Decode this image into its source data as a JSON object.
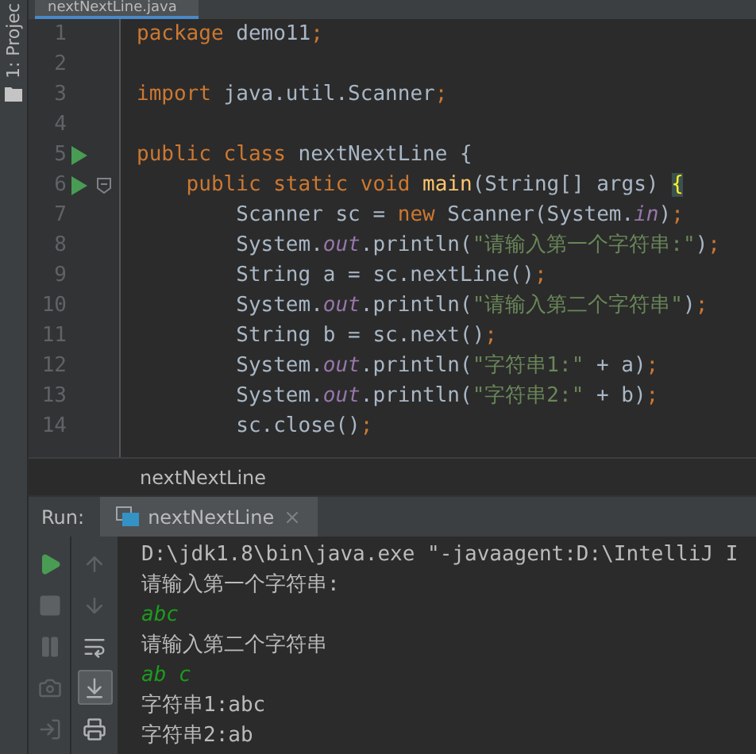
{
  "side_panel": {
    "label": "1: Projec"
  },
  "editor_tab": {
    "label": "nextNextLine.java"
  },
  "code_lines": [
    {
      "number": "1",
      "run_icon": false,
      "fold_marker": false,
      "tokens": [
        {
          "t": "package",
          "kind": "kw"
        },
        {
          "t": " demo11",
          "kind": "plain"
        },
        {
          "t": ";",
          "kind": "kw"
        }
      ]
    },
    {
      "number": "2",
      "run_icon": false,
      "fold_marker": false
    },
    {
      "number": "3",
      "run_icon": false,
      "fold_marker": false,
      "tokens": [
        {
          "t": "import",
          "kind": "kw"
        },
        {
          "t": " java.util.Scanner",
          "kind": "plain"
        },
        {
          "t": ";",
          "kind": "kw"
        }
      ]
    },
    {
      "number": "4",
      "run_icon": false,
      "fold_marker": false
    },
    {
      "number": "5",
      "run_icon": true,
      "fold_marker": false,
      "tokens": [
        {
          "t": "public class",
          "kind": "kw"
        },
        {
          "t": " nextNextLine {",
          "kind": "plain"
        }
      ]
    },
    {
      "number": "6",
      "run_icon": true,
      "fold_marker": true,
      "tokens": [
        {
          "t": "    public static void ",
          "kind": "kw"
        },
        {
          "t": "main",
          "kind": "method"
        },
        {
          "t": "(String[] args) ",
          "kind": "plain"
        },
        {
          "t": "{",
          "kind": "match"
        }
      ]
    },
    {
      "number": "7",
      "run_icon": false,
      "fold_marker": false,
      "tokens": [
        {
          "t": "        Scanner sc = ",
          "kind": "plain"
        },
        {
          "t": "new",
          "kind": "kw"
        },
        {
          "t": " Scanner(System.",
          "kind": "plain"
        },
        {
          "t": "in",
          "kind": "field"
        },
        {
          "t": ")",
          "kind": "plain"
        },
        {
          "t": ";",
          "kind": "kw"
        }
      ]
    },
    {
      "number": "8",
      "run_icon": false,
      "fold_marker": false,
      "tokens": [
        {
          "t": "        System.",
          "kind": "plain"
        },
        {
          "t": "out",
          "kind": "field"
        },
        {
          "t": ".println(",
          "kind": "plain"
        },
        {
          "t": "\"请输入第一个字符串:\"",
          "kind": "str"
        },
        {
          "t": ")",
          "kind": "plain"
        },
        {
          "t": ";",
          "kind": "kw"
        }
      ]
    },
    {
      "number": "9",
      "run_icon": false,
      "fold_marker": false,
      "tokens": [
        {
          "t": "        String a = sc.nextLine()",
          "kind": "plain"
        },
        {
          "t": ";",
          "kind": "kw"
        }
      ]
    },
    {
      "number": "10",
      "run_icon": false,
      "fold_marker": false,
      "tokens": [
        {
          "t": "        System.",
          "kind": "plain"
        },
        {
          "t": "out",
          "kind": "field"
        },
        {
          "t": ".println(",
          "kind": "plain"
        },
        {
          "t": "\"请输入第二个字符串\"",
          "kind": "str"
        },
        {
          "t": ")",
          "kind": "plain"
        },
        {
          "t": ";",
          "kind": "kw"
        }
      ]
    },
    {
      "number": "11",
      "run_icon": false,
      "fold_marker": false,
      "tokens": [
        {
          "t": "        String b = sc.next()",
          "kind": "plain"
        },
        {
          "t": ";",
          "kind": "kw"
        }
      ]
    },
    {
      "number": "12",
      "run_icon": false,
      "fold_marker": false,
      "tokens": [
        {
          "t": "        System.",
          "kind": "plain"
        },
        {
          "t": "out",
          "kind": "field"
        },
        {
          "t": ".println(",
          "kind": "plain"
        },
        {
          "t": "\"字符串1:\"",
          "kind": "str"
        },
        {
          "t": " + a)",
          "kind": "plain"
        },
        {
          "t": ";",
          "kind": "kw"
        }
      ]
    },
    {
      "number": "13",
      "run_icon": false,
      "fold_marker": false,
      "tokens": [
        {
          "t": "        System.",
          "kind": "plain"
        },
        {
          "t": "out",
          "kind": "field"
        },
        {
          "t": ".println(",
          "kind": "plain"
        },
        {
          "t": "\"字符串2:\"",
          "kind": "str"
        },
        {
          "t": " + b)",
          "kind": "plain"
        },
        {
          "t": ";",
          "kind": "kw"
        }
      ]
    },
    {
      "number": "14",
      "run_icon": false,
      "fold_marker": false,
      "tokens": [
        {
          "t": "        sc.close()",
          "kind": "plain"
        },
        {
          "t": ";",
          "kind": "kw"
        }
      ]
    }
  ],
  "breadcrumb": "nextNextLine",
  "run_panel": {
    "label": "Run:",
    "tab": {
      "label": "nextNextLine",
      "selected": true
    }
  },
  "toolbar_left": [
    {
      "kind": "run",
      "disabled": false
    },
    {
      "kind": "stop",
      "disabled": true
    },
    {
      "kind": "pause",
      "disabled": true
    },
    {
      "kind": "camera",
      "disabled": true
    },
    {
      "kind": "exit",
      "disabled": true
    }
  ],
  "toolbar_right": [
    {
      "kind": "up",
      "disabled": true,
      "selected": false
    },
    {
      "kind": "down",
      "disabled": true,
      "selected": false
    },
    {
      "kind": "wrap",
      "disabled": false,
      "selected": false
    },
    {
      "kind": "scroll-end",
      "disabled": false,
      "selected": true
    },
    {
      "kind": "print",
      "disabled": false,
      "selected": false
    }
  ],
  "console_lines": [
    {
      "kind": "output",
      "text": "D:\\jdk1.8\\bin\\java.exe \"-javaagent:D:\\IntelliJ I"
    },
    {
      "kind": "output",
      "text": "请输入第一个字符串:"
    },
    {
      "kind": "input",
      "text": "abc"
    },
    {
      "kind": "output",
      "text": "请输入第二个字符串"
    },
    {
      "kind": "input",
      "text": "ab c"
    },
    {
      "kind": "output",
      "text": "字符串1:abc"
    },
    {
      "kind": "output",
      "text": "字符串2:ab"
    }
  ]
}
